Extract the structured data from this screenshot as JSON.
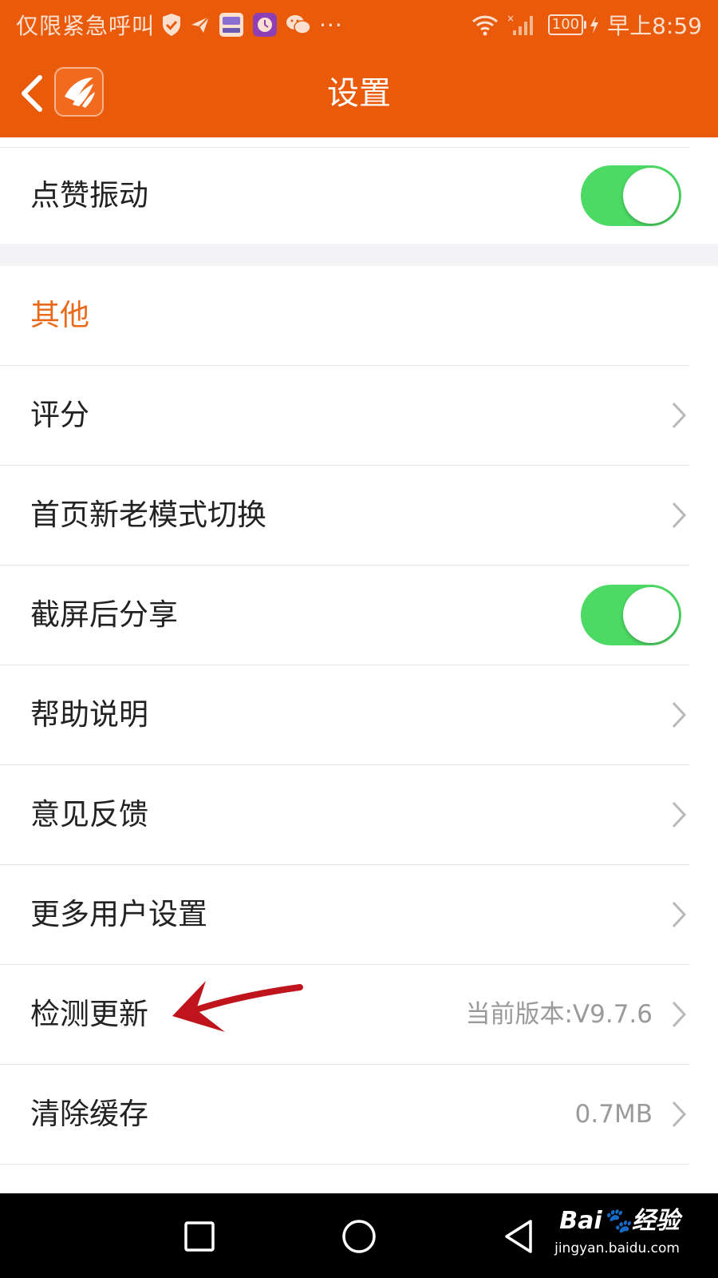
{
  "status_bar": {
    "carrier": "仅限紧急呼叫",
    "battery": "100",
    "time": "早上8:59",
    "more": "···"
  },
  "header": {
    "title": "设置"
  },
  "rows": {
    "like_vibration": {
      "label": "点赞振动",
      "toggle_on": true
    },
    "section_other": {
      "label": "其他"
    },
    "rating": {
      "label": "评分"
    },
    "home_mode": {
      "label": "首页新老模式切换"
    },
    "screenshot_share": {
      "label": "截屏后分享",
      "toggle_on": true
    },
    "help": {
      "label": "帮助说明"
    },
    "feedback": {
      "label": "意见反馈"
    },
    "more_user_settings": {
      "label": "更多用户设置"
    },
    "check_update": {
      "label": "检测更新",
      "value": "当前版本:V9.7.6"
    },
    "clear_cache": {
      "label": "清除缓存",
      "value": "0.7MB"
    }
  },
  "watermark": {
    "brand": "Bai🐾经验",
    "url": "jingyan.baidu.com"
  },
  "colors": {
    "brand_orange": "#ea5a0b",
    "section_orange": "#ea6a1c",
    "toggle_green": "#4cd964",
    "arrow_red": "#c0141c"
  },
  "icons": {
    "status": [
      "shield-check-icon",
      "paper-plane-icon",
      "calendar-app-icon",
      "clock-app-icon",
      "wechat-icon",
      "wifi-icon",
      "signal-icon",
      "charging-icon"
    ],
    "nav": [
      "recent-apps-icon",
      "home-icon",
      "back-triangle-icon"
    ]
  }
}
